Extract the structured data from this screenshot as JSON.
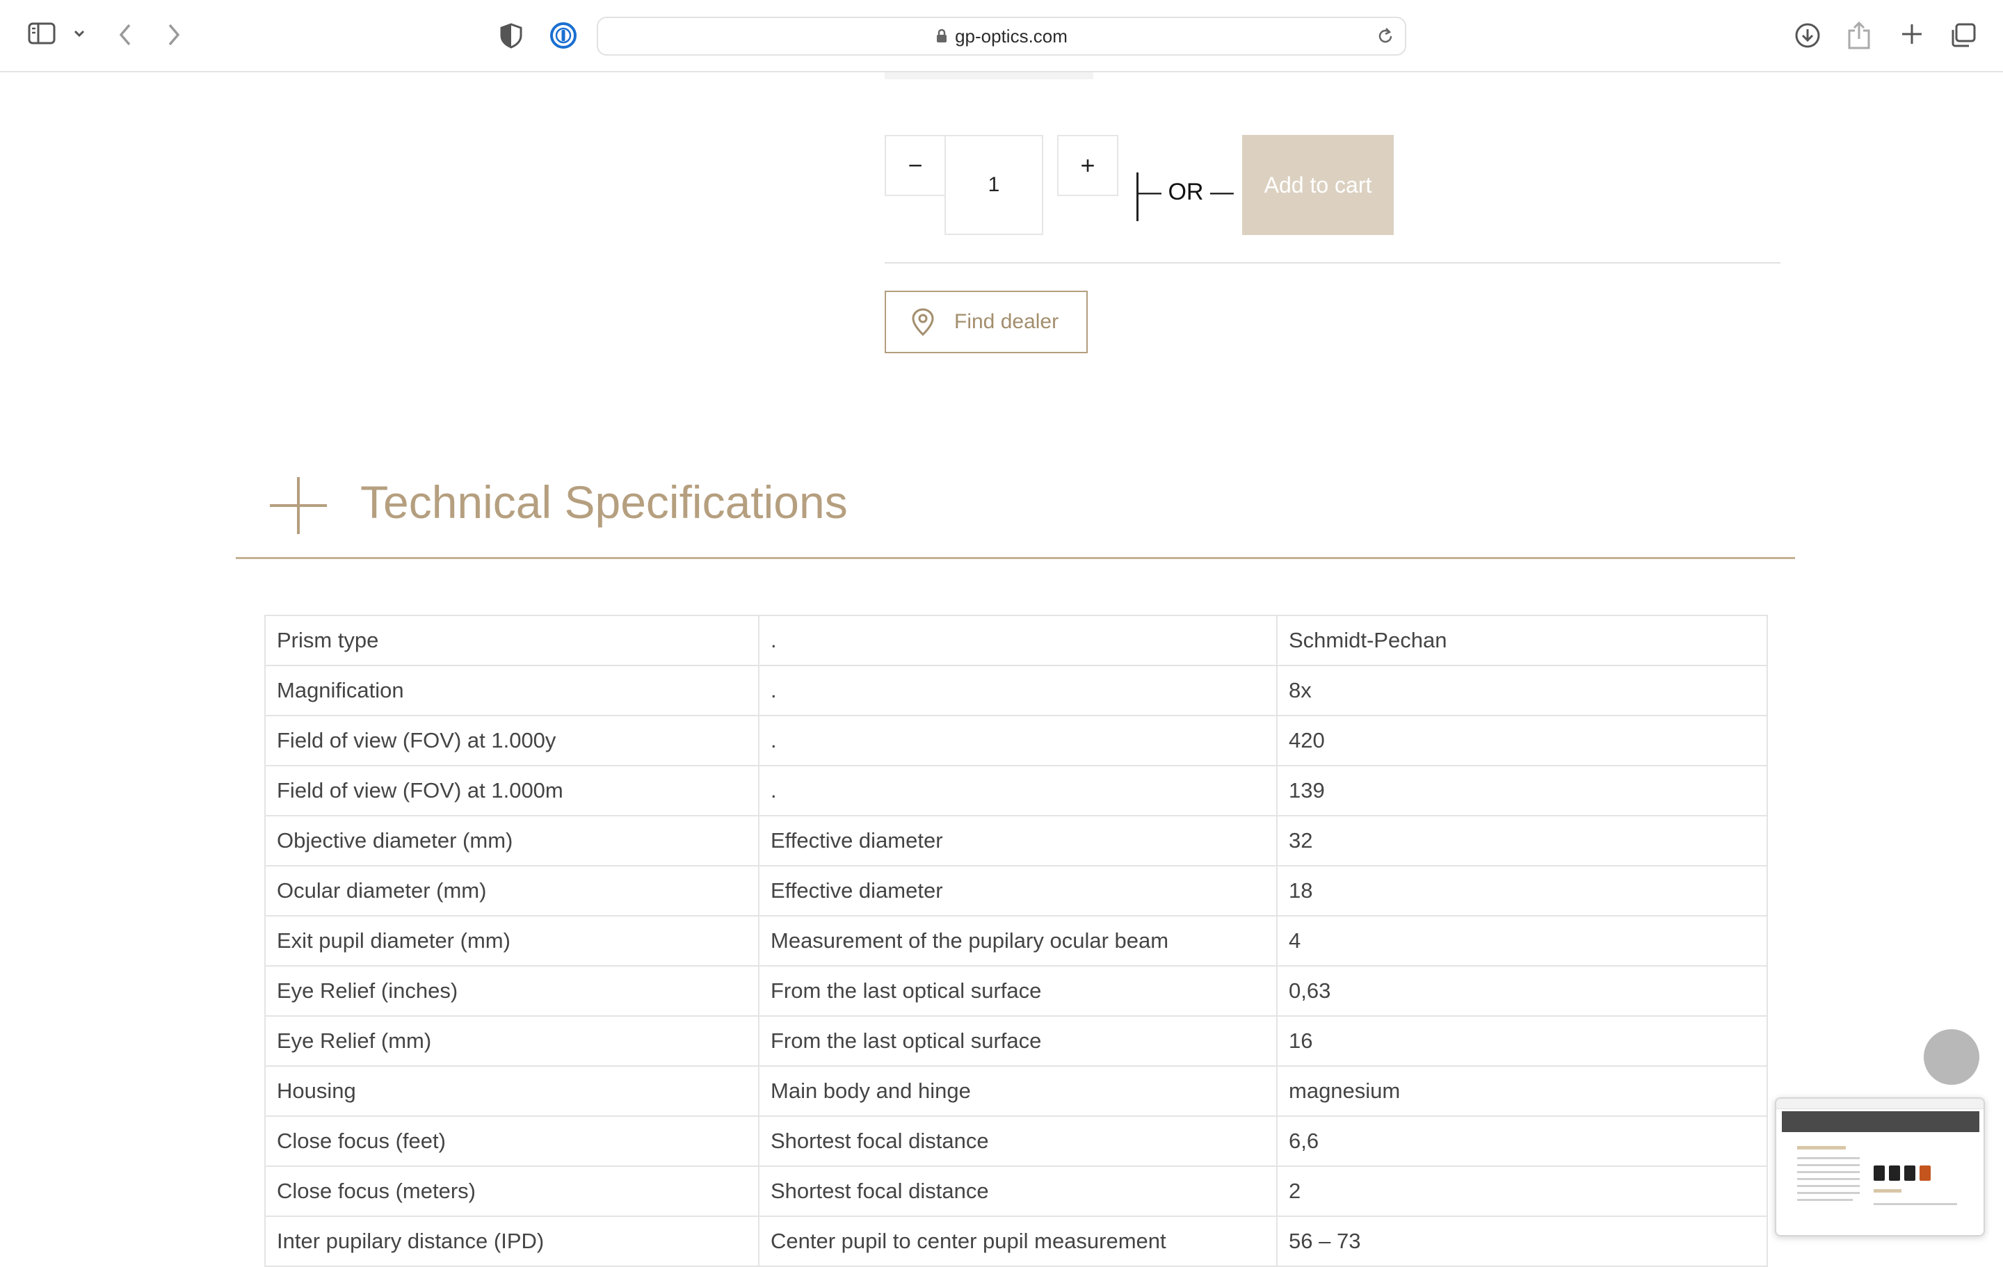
{
  "browser": {
    "url": "gp-optics.com"
  },
  "purchase": {
    "quantity_minus": "−",
    "quantity_plus": "+",
    "quantity_value": "1",
    "or_separator": "— OR —",
    "add_to_cart_label": "Add to cart",
    "find_dealer_label": "Find dealer"
  },
  "specs": {
    "title": "Technical Specifications",
    "rows": [
      [
        "Prism type",
        ".",
        "Schmidt-Pechan"
      ],
      [
        "Magnification",
        ".",
        "8x"
      ],
      [
        "Field of view (FOV) at 1.000y",
        ".",
        "420"
      ],
      [
        "Field of view (FOV) at 1.000m",
        ".",
        "139"
      ],
      [
        "Objective diameter (mm)",
        "Effective diameter",
        "32"
      ],
      [
        "Ocular diameter (mm)",
        "Effective diameter",
        "18"
      ],
      [
        "Exit pupil diameter (mm)",
        "Measurement of the pupilary ocular beam",
        "4"
      ],
      [
        "Eye Relief (inches)",
        "From the last optical surface",
        "0,63"
      ],
      [
        "Eye Relief (mm)",
        "From the last optical surface",
        "16"
      ],
      [
        "Housing",
        "Main body and hinge",
        "magnesium"
      ],
      [
        "Close focus (feet)",
        "Shortest focal distance",
        "6,6"
      ],
      [
        "Close focus (meters)",
        "Shortest focal distance",
        "2"
      ],
      [
        "Inter pupilary distance (IPD)",
        "Center pupil to center pupil measurement",
        "56 – 73"
      ]
    ]
  },
  "colors": {
    "accent_gold": "#b59f7f",
    "cart_button": "#dcd1c1"
  }
}
